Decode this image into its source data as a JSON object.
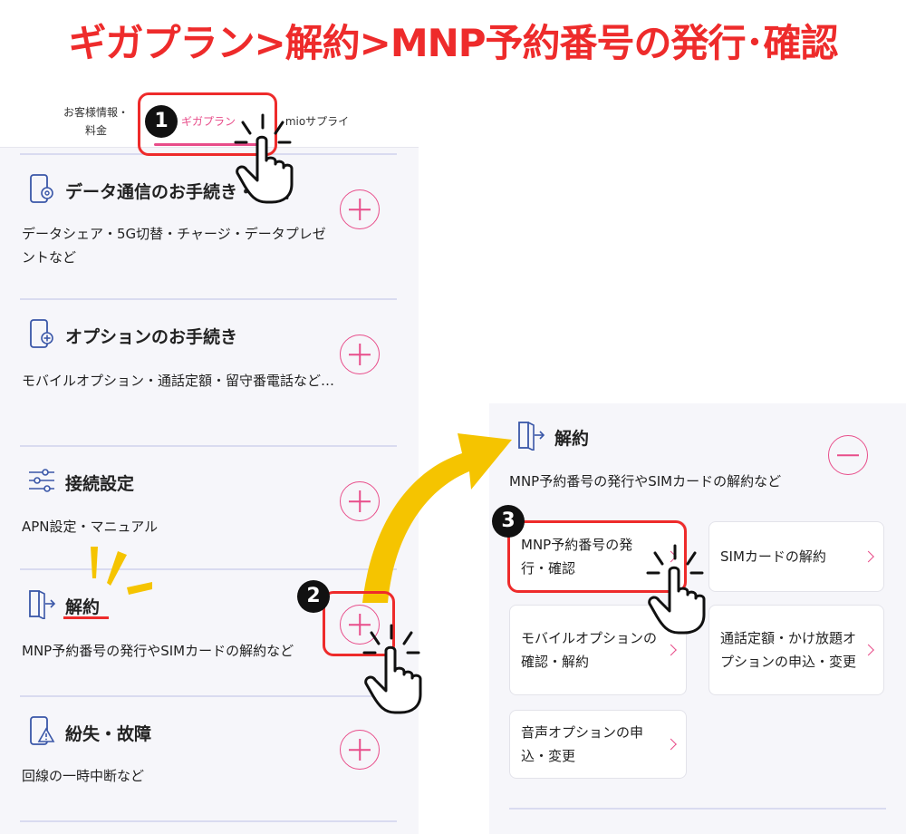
{
  "page_title": "ギガプラン>解約>MNP予約番号の発行･確認",
  "tabs": [
    {
      "label": "お客様情報・\n料金"
    },
    {
      "label": "ギガプラン"
    },
    {
      "label": "mioサプライ"
    }
  ],
  "sections": [
    {
      "title": "データ通信のお手続き・設定",
      "desc": "データシェア・5G切替・チャージ・データプレゼントなど",
      "icon": "phone-gear-icon"
    },
    {
      "title": "オプションのお手続き",
      "desc": "モバイルオプション・通話定額・留守番電話など…",
      "icon": "phone-plus-icon"
    },
    {
      "title": "接続設定",
      "desc": "APN設定・マニュアル",
      "icon": "sliders-icon"
    },
    {
      "title": "解約",
      "desc": "MNP予約番号の発行やSIMカードの解約など",
      "icon": "exit-door-icon"
    },
    {
      "title": "紛失・故障",
      "desc": "回線の一時中断など",
      "icon": "phone-warning-icon"
    }
  ],
  "expanded": {
    "title": "解約",
    "desc": "MNP予約番号の発行やSIMカードの解約など",
    "cards": [
      {
        "label": "MNP予約番号の発行・確認"
      },
      {
        "label": "SIMカードの解約"
      },
      {
        "label": "モバイルオプションの確認・解約"
      },
      {
        "label": "通話定額・かけ放題オプションの申込・変更"
      },
      {
        "label": "音声オプションの申込・変更"
      }
    ]
  },
  "steps": [
    "1",
    "2",
    "3"
  ],
  "colors": {
    "accent": "#e84d8a",
    "highlight": "#ee2b2b",
    "arrow": "#f5c400",
    "panel": "#f6f6fa"
  }
}
